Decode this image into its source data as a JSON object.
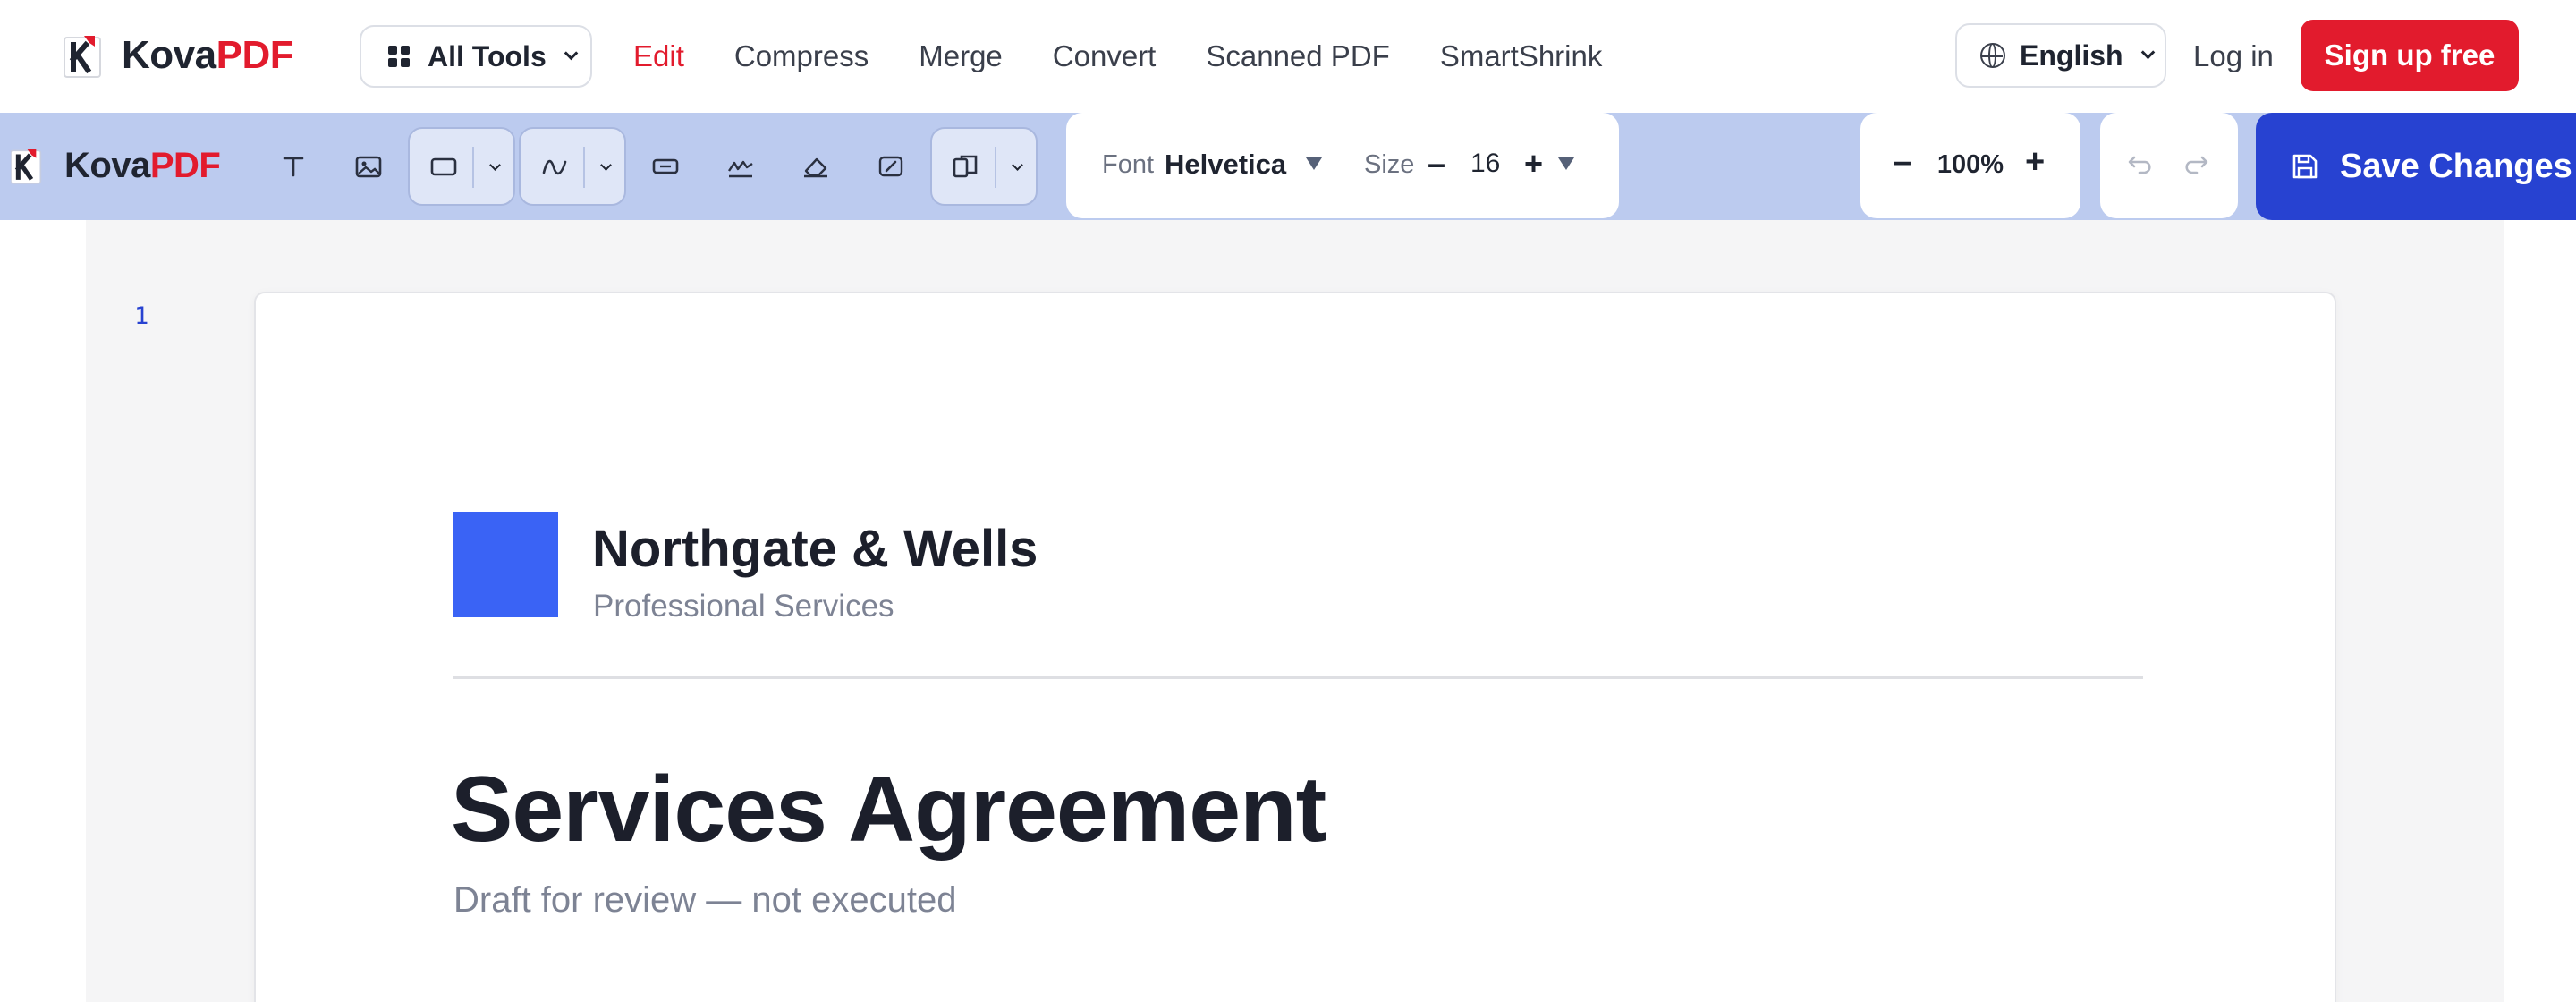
{
  "brand": {
    "name_part1": "Kova",
    "name_part2": "PDF"
  },
  "topnav": {
    "all_tools_label": "All Tools",
    "links": [
      {
        "label": "Edit",
        "active": true
      },
      {
        "label": "Compress",
        "active": false
      },
      {
        "label": "Merge",
        "active": false
      },
      {
        "label": "Convert",
        "active": false
      },
      {
        "label": "Scanned PDF",
        "active": false
      },
      {
        "label": "SmartShrink",
        "active": false
      }
    ],
    "language": "English",
    "login_label": "Log in",
    "signup_label": "Sign up free"
  },
  "toolbar": {
    "tools": [
      "text-tool",
      "image-tool",
      "rectangle-tool",
      "draw-tool",
      "form-field-tool",
      "signature-tool",
      "eraser-tool",
      "edit-box-tool",
      "page-layout-tool"
    ],
    "font_label": "Font",
    "font_value": "Helvetica",
    "size_label": "Size",
    "size_value": "16",
    "size_decrement": "–",
    "size_increment": "+",
    "zoom_decrement": "–",
    "zoom_value": "100%",
    "zoom_increment": "+",
    "save_label": "Save Changes"
  },
  "document": {
    "page_number": "1",
    "company_name": "Northgate & Wells",
    "company_tagline": "Professional Services",
    "title": "Services Agreement",
    "subtitle": "Draft for review — not executed"
  },
  "colors": {
    "brand_red": "#e21b2d",
    "toolbar_bg": "#bccbef",
    "save_blue": "#2742d1",
    "logo_square": "#3a63f5"
  }
}
